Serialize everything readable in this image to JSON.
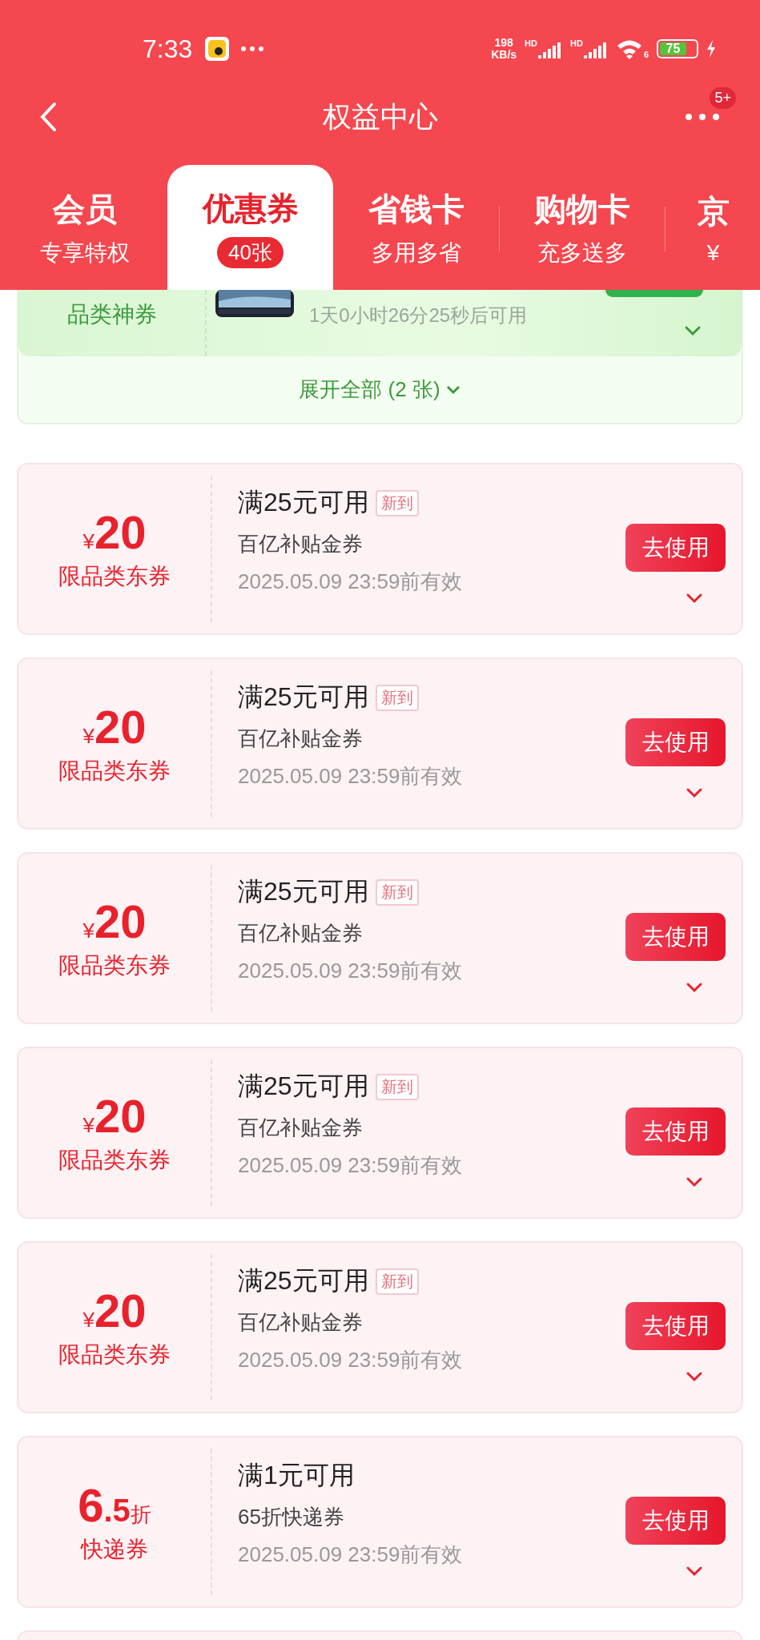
{
  "status_bar": {
    "time": "7:33",
    "speed_value": "198",
    "speed_unit": "KB/s",
    "network_labels": [
      "HD",
      "HD"
    ],
    "wifi_label": "6",
    "battery": "75"
  },
  "nav": {
    "title": "权益中心",
    "badge": "5+"
  },
  "tabs": [
    {
      "title": "会员",
      "subtitle": "专享特权",
      "selected": false
    },
    {
      "title": "优惠券",
      "badge": "40张",
      "selected": true
    },
    {
      "title": "省钱卡",
      "subtitle": "多用多省",
      "selected": false
    },
    {
      "title": "购物卡",
      "subtitle": "充多送多",
      "selected": false
    },
    {
      "title": "京",
      "subtitle": "¥",
      "selected": false
    }
  ],
  "featured": {
    "label": "品类神券",
    "countdown": "1天0小时26分25秒后可用",
    "expand": "展开全部 (2 张)"
  },
  "coupons": [
    {
      "kind": "amount",
      "prefix": "¥",
      "main": "20",
      "category": "限品类东券",
      "condition": "满25元可用",
      "tag": "新到",
      "name": "百亿补贴金券",
      "validity": "2025.05.09 23:59前有效",
      "button": "去使用"
    },
    {
      "kind": "amount",
      "prefix": "¥",
      "main": "20",
      "category": "限品类东券",
      "condition": "满25元可用",
      "tag": "新到",
      "name": "百亿补贴金券",
      "validity": "2025.05.09 23:59前有效",
      "button": "去使用"
    },
    {
      "kind": "amount",
      "prefix": "¥",
      "main": "20",
      "category": "限品类东券",
      "condition": "满25元可用",
      "tag": "新到",
      "name": "百亿补贴金券",
      "validity": "2025.05.09 23:59前有效",
      "button": "去使用"
    },
    {
      "kind": "amount",
      "prefix": "¥",
      "main": "20",
      "category": "限品类东券",
      "condition": "满25元可用",
      "tag": "新到",
      "name": "百亿补贴金券",
      "validity": "2025.05.09 23:59前有效",
      "button": "去使用"
    },
    {
      "kind": "amount",
      "prefix": "¥",
      "main": "20",
      "category": "限品类东券",
      "condition": "满25元可用",
      "tag": "新到",
      "name": "百亿补贴金券",
      "validity": "2025.05.09 23:59前有效",
      "button": "去使用"
    },
    {
      "kind": "discount",
      "main": "6",
      "minor": ".5",
      "suffix": "折",
      "category": "快递券",
      "condition": "满1元可用",
      "name": "65折快递券",
      "validity": "2025.05.09 23:59前有效",
      "button": "去使用"
    }
  ]
}
